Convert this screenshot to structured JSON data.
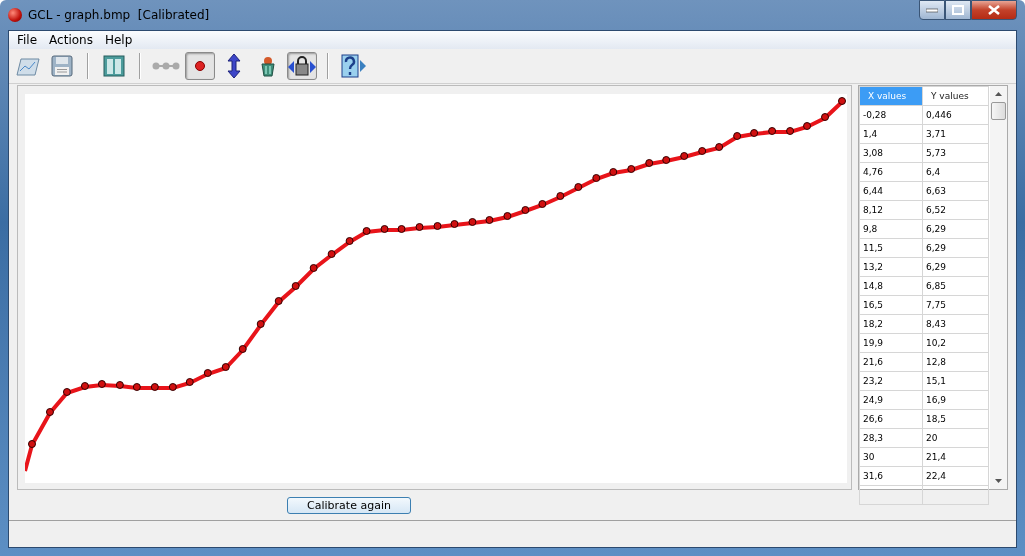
{
  "window": {
    "title": "GCL - graph.bmp  [Calibrated]"
  },
  "menu": [
    "File",
    "Actions",
    "Help"
  ],
  "toolbar": [
    {
      "kind": "chart",
      "selected": false
    },
    {
      "kind": "save",
      "selected": false
    },
    {
      "kind": "separator"
    },
    {
      "kind": "table",
      "selected": false
    },
    {
      "kind": "separator"
    },
    {
      "kind": "line",
      "selected": false
    },
    {
      "kind": "point",
      "selected": true
    },
    {
      "kind": "arrows",
      "selected": false
    },
    {
      "kind": "trash",
      "selected": false
    },
    {
      "kind": "lock",
      "selected": true
    },
    {
      "kind": "separator"
    },
    {
      "kind": "help",
      "selected": false
    }
  ],
  "table": {
    "columns": [
      {
        "label": "X values",
        "selected": true
      },
      {
        "label": "Y values",
        "selected": false
      }
    ],
    "rows": [
      [
        "-0,28",
        "0,446"
      ],
      [
        "1,4",
        "3,71"
      ],
      [
        "3,08",
        "5,73"
      ],
      [
        "4,76",
        "6,4"
      ],
      [
        "6,44",
        "6,63"
      ],
      [
        "8,12",
        "6,52"
      ],
      [
        "9,8",
        "6,29"
      ],
      [
        "11,5",
        "6,29"
      ],
      [
        "13,2",
        "6,29"
      ],
      [
        "14,8",
        "6,85"
      ],
      [
        "16,5",
        "7,75"
      ],
      [
        "18,2",
        "8,43"
      ],
      [
        "19,9",
        "10,2"
      ],
      [
        "21,6",
        "12,8"
      ],
      [
        "23,2",
        "15,1"
      ],
      [
        "24,9",
        "16,9"
      ],
      [
        "26,6",
        "18,5"
      ],
      [
        "28,3",
        "20"
      ],
      [
        "30",
        "21,4"
      ],
      [
        "31,6",
        "22,4"
      ]
    ]
  },
  "calibrate_button": "Calibrate again"
}
